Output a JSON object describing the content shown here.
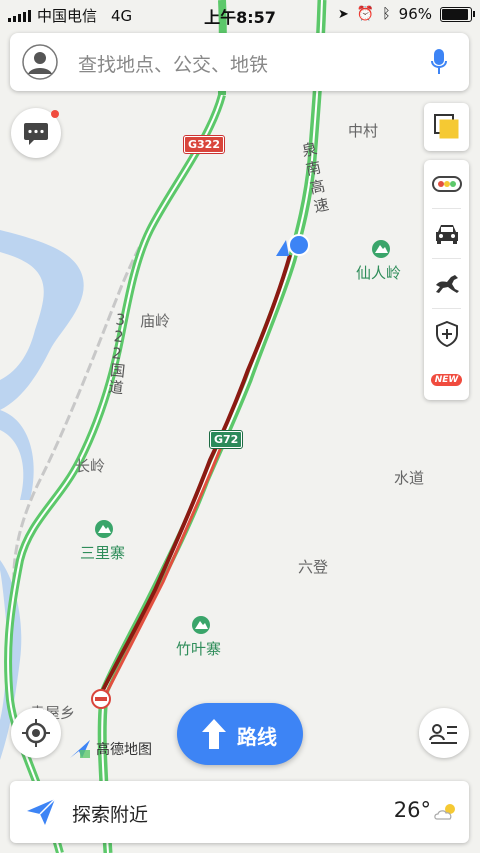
{
  "status_bar": {
    "carrier": "中国电信",
    "network": "4G",
    "time": "上午8:57",
    "battery": "96%"
  },
  "search": {
    "placeholder": "查找地点、公交、地铁"
  },
  "map": {
    "roads": {
      "g322": "G322",
      "g72": "G72",
      "national_road_vertical": [
        "3",
        "2",
        "2",
        "国",
        "道"
      ],
      "expressway_vertical": [
        "泉",
        "南",
        "高",
        "速"
      ]
    },
    "places": {
      "zhongcun": "中村",
      "miaoling": "庙岭",
      "changling": "长岭",
      "shuidao": "水道",
      "liudeng": "六登",
      "yuanxiang": "袁屋乡"
    },
    "pois": {
      "xianrenling": "仙人岭",
      "sanlizhai": "三里寨",
      "zhuyezhai": "竹叶寨"
    },
    "logo_text": "高德地图"
  },
  "toolbar": {
    "new_badge": "NEW"
  },
  "route_button": {
    "label": "路线"
  },
  "bottom_bar": {
    "label": "探索附近",
    "temperature": "26°"
  },
  "colors": {
    "accent": "#3d84f5",
    "road_green": "#5cc86a",
    "route_dark": "#8b1a12",
    "route_red": "#e25040",
    "poi_green": "#2f8d5a"
  }
}
